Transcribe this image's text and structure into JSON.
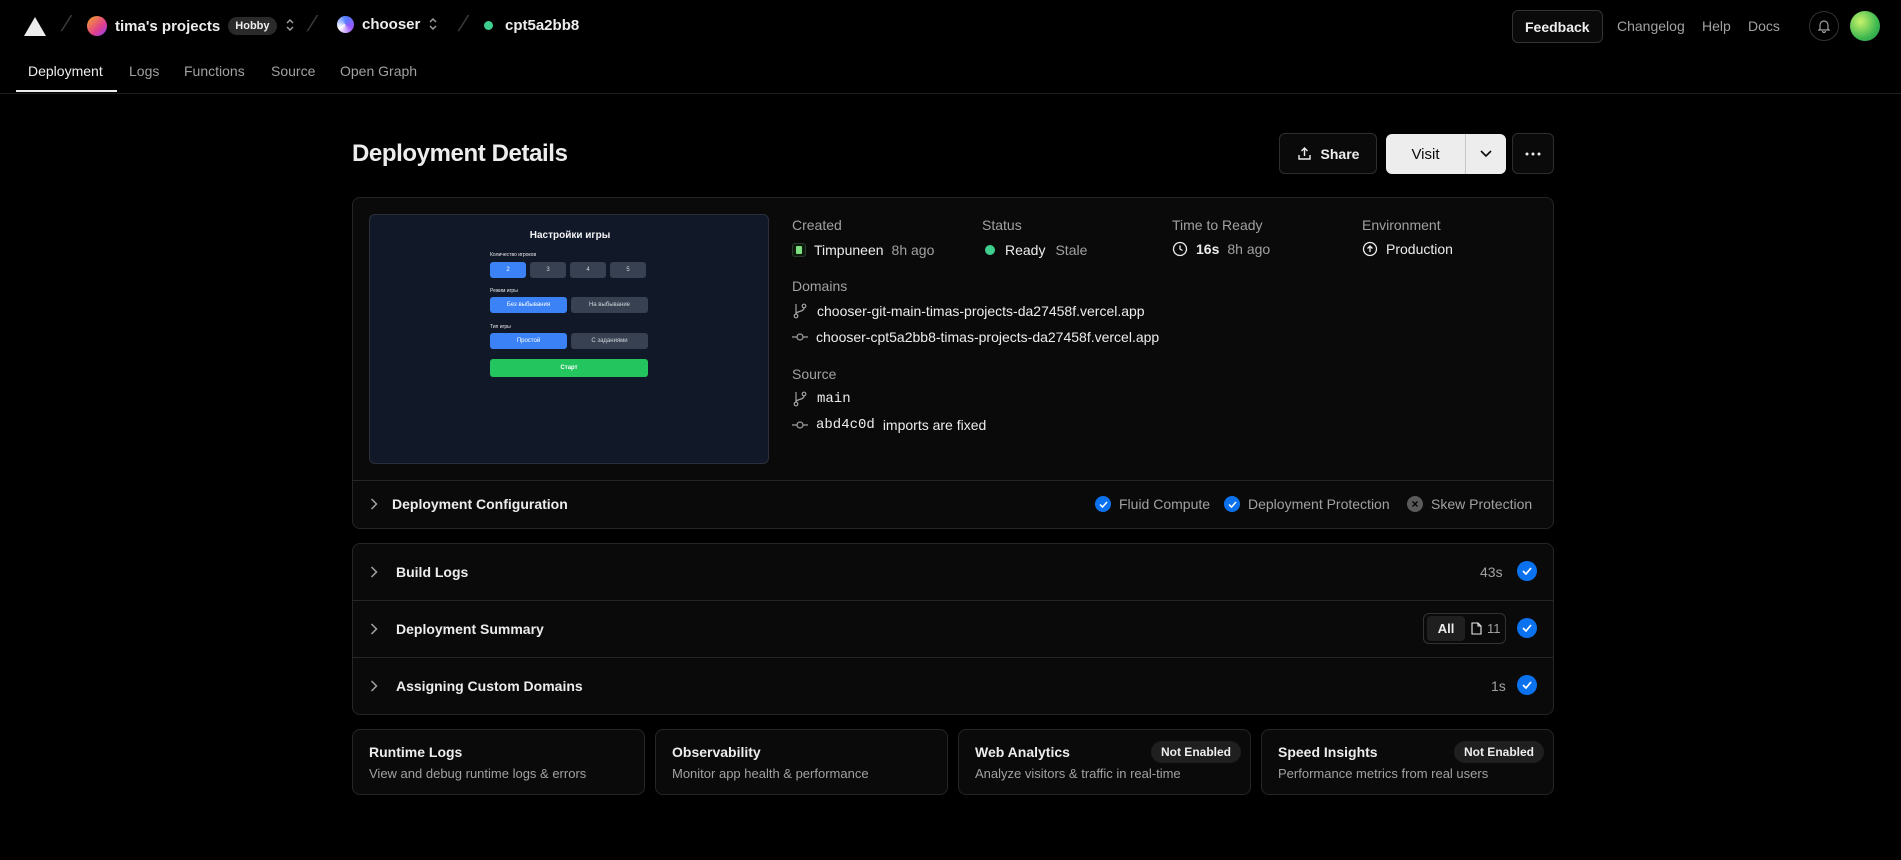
{
  "topbar": {
    "scope_name": "tima's projects",
    "plan_badge": "Hobby",
    "project_name": "chooser",
    "deployment_id": "cpt5a2bb8",
    "feedback_label": "Feedback",
    "links": [
      "Changelog",
      "Help",
      "Docs"
    ]
  },
  "tabs": [
    "Deployment",
    "Logs",
    "Functions",
    "Source",
    "Open Graph"
  ],
  "active_tab": "Deployment",
  "header": {
    "title": "Deployment Details",
    "share_label": "Share",
    "visit_label": "Visit"
  },
  "preview": {
    "heading": "Настройки игры",
    "players_label": "Количество игроков",
    "player_options": [
      "2",
      "3",
      "4",
      "5"
    ],
    "mode_label": "Режим игры",
    "mode_options": [
      "Без выбывания",
      "На выбывание"
    ],
    "type_label": "Тип игры",
    "type_options": [
      "Простой",
      "С заданиями"
    ],
    "start_label": "Старт"
  },
  "details": {
    "created_label": "Created",
    "created_user": "Timpuneen",
    "created_time": "8h ago",
    "status_label": "Status",
    "status_value": "Ready",
    "status_extra": "Stale",
    "ttr_label": "Time to Ready",
    "ttr_value": "16s",
    "ttr_time": "8h ago",
    "env_label": "Environment",
    "env_value": "Production",
    "domains_label": "Domains",
    "domains": [
      "chooser-git-main-timas-projects-da27458f.vercel.app",
      "chooser-cpt5a2bb8-timas-projects-da27458f.vercel.app"
    ],
    "source_label": "Source",
    "branch": "main",
    "commit_hash": "abd4c0d",
    "commit_message": "imports are fixed"
  },
  "config": {
    "title": "Deployment Configuration",
    "features": [
      {
        "label": "Fluid Compute",
        "enabled": true
      },
      {
        "label": "Deployment Protection",
        "enabled": true
      },
      {
        "label": "Skew Protection",
        "enabled": false
      }
    ]
  },
  "sections": [
    {
      "title": "Build Logs",
      "meta": "43s"
    },
    {
      "title": "Deployment Summary",
      "filter": "All",
      "count": "11"
    },
    {
      "title": "Assigning Custom Domains",
      "meta": "1s"
    }
  ],
  "bottom_cards": [
    {
      "title": "Runtime Logs",
      "desc": "View and debug runtime logs & errors"
    },
    {
      "title": "Observability",
      "desc": "Monitor app health & performance"
    },
    {
      "title": "Web Analytics",
      "desc": "Analyze visitors & traffic in real-time",
      "badge": "Not Enabled"
    },
    {
      "title": "Speed Insights",
      "desc": "Performance metrics from real users",
      "badge": "Not Enabled"
    }
  ],
  "colors": {
    "background": "#000000",
    "accent_blue": "#0a72ef",
    "ready_green": "#3ecf8e"
  }
}
